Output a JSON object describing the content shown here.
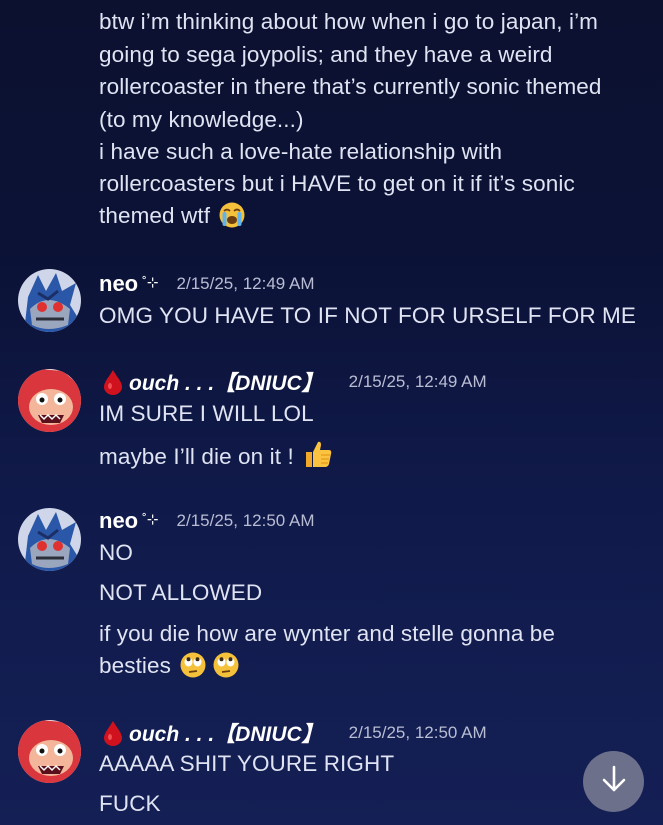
{
  "intro_lines": [
    "btw i’m thinking about how when i go to japan, i’m",
    "going to sega joypolis; and they have a weird",
    "rollercoaster in there that’s currently sonic themed",
    "(to my knowledge...)",
    "i have such a love-hate relationship with",
    "rollercoasters but i HAVE to get on it if it’s sonic",
    "themed wtf"
  ],
  "messages": [
    {
      "author": "neo",
      "author_decor": "˚⊹",
      "timestamp": "2/15/25, 12:49 AM",
      "lines": [
        "OMG YOU HAVE TO IF NOT FOR URSELF FOR ME"
      ]
    },
    {
      "author": "ouch . . .【DNIUC】",
      "timestamp": "2/15/25, 12:49 AM",
      "lines": [
        "IM SURE I WILL LOL",
        "maybe I’ll die on it !"
      ]
    },
    {
      "author": "neo",
      "author_decor": "˚⊹",
      "timestamp": "2/15/25, 12:50 AM",
      "lines": [
        "NO",
        "NOT ALLOWED",
        "if you die how are wynter and stelle gonna be",
        "besties"
      ]
    },
    {
      "author": "ouch . . .【DNIUC】",
      "timestamp": "2/15/25, 12:50 AM",
      "lines": [
        "AAAAA SHIT YOURE RIGHT",
        "FUCK"
      ]
    }
  ],
  "icons": {
    "crying_emoji": "loudly-crying-face",
    "thumbs_up_emoji": "thumbs-up",
    "eye_roll_emoji": "face-with-rolling-eyes",
    "blood_drop": "drop-of-blood",
    "scroll_down": "arrow-down"
  },
  "colors": {
    "background_top": "#0c1130",
    "background_bottom": "#141f55",
    "text": "#dfe3f2",
    "username": "#ffffff",
    "timestamp": "#b9bdd3",
    "scroll_button": "#6c708a"
  }
}
